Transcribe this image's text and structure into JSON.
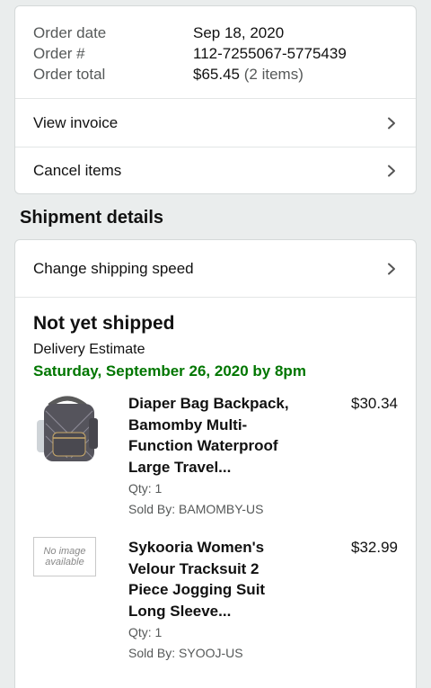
{
  "summary": {
    "rows": [
      {
        "label": "Order date",
        "value": "Sep 18, 2020"
      },
      {
        "label": "Order #",
        "value": "112-7255067-5775439"
      },
      {
        "label": "Order total",
        "value": "$65.45",
        "extra": "(2 items)"
      }
    ],
    "links": [
      {
        "label": "View invoice"
      },
      {
        "label": "Cancel items"
      }
    ]
  },
  "shipment": {
    "heading": "Shipment details",
    "change_speed": "Change shipping speed",
    "status": "Not yet shipped",
    "delivery_label": "Delivery Estimate",
    "delivery_date": "Saturday, September 26, 2020 by 8pm",
    "items": [
      {
        "title": "Diaper Bag Backpack, Bamomby Multi-Function Waterproof Large Travel...",
        "price": "$30.34",
        "qty": "Qty: 1",
        "seller": "Sold By: BAMOMBY-US",
        "image": "backpack-image"
      },
      {
        "title": "Sykooria Women's Velour Tracksuit 2 Piece Jogging Suit Long Sleeve...",
        "price": "$32.99",
        "qty": "Qty: 1",
        "seller": "Sold By: SYOOJ-US",
        "image": "no-image-placeholder",
        "placeholder_line1": "No image",
        "placeholder_line2": "available"
      }
    ]
  },
  "colors": {
    "delivery_green": "#007600",
    "muted_text": "#565959",
    "border": "#d5d9d9"
  }
}
